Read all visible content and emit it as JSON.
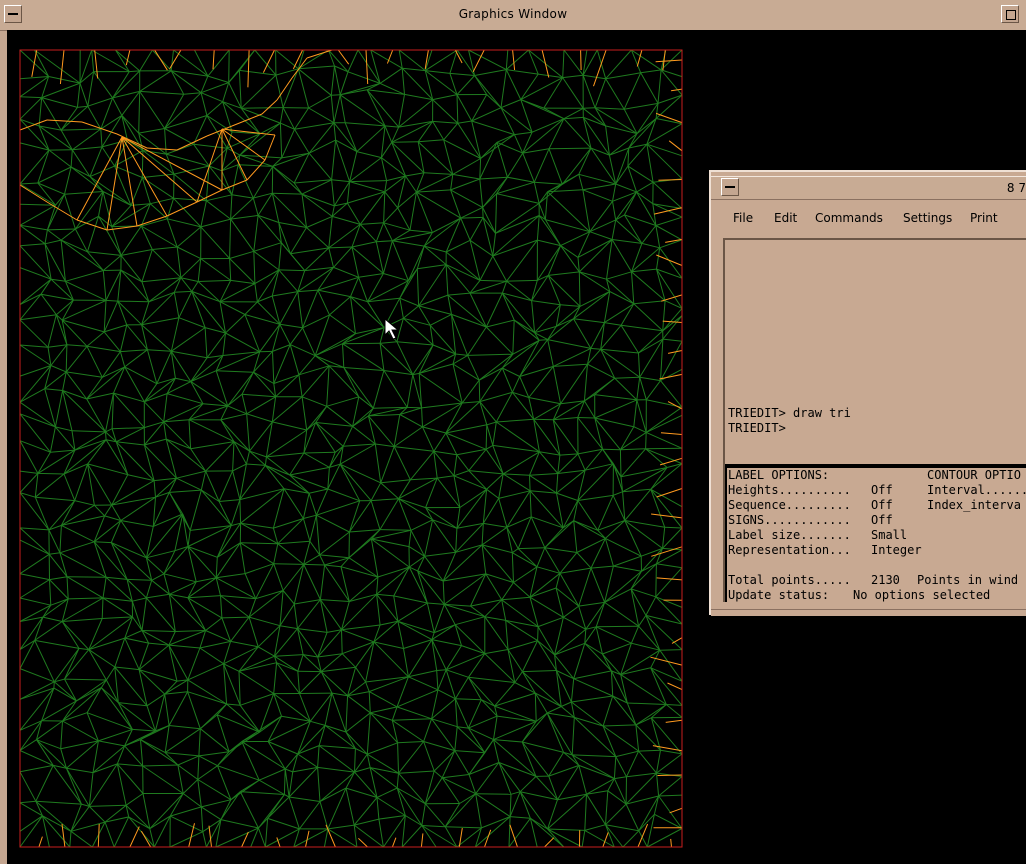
{
  "graphics_window": {
    "title": "Graphics Window"
  },
  "mesh": {
    "background": "#000000",
    "edge_color": "#1f7a1f",
    "boundary_color": "#ff9a1f",
    "frame_color": "#c81e1e"
  },
  "tool_window": {
    "title": "8 7",
    "menu": [
      "File",
      "Edit",
      "Commands",
      "Settings",
      "Print"
    ],
    "console_lines": [
      "TRIEDIT> draw tri",
      "TRIEDIT>"
    ],
    "status": {
      "label_options_header": "LABEL OPTIONS:",
      "contour_options_header": "CONTOUR OPTIO",
      "label_options": [
        {
          "name": "Heights..........",
          "value": "Off"
        },
        {
          "name": "Sequence.........",
          "value": "Off"
        },
        {
          "name": "SIGNS............",
          "value": "Off"
        },
        {
          "name": "Label size.......",
          "value": "Small"
        },
        {
          "name": "Representation...",
          "value": "Integer"
        }
      ],
      "contour_options": [
        "Interval......",
        "Index_interva"
      ],
      "total_points_label": "Total points.....",
      "total_points_value": "2130",
      "points_in_window_label": "Points in wind",
      "update_status_label": "Update status:",
      "update_status_value": "No options selected"
    }
  }
}
